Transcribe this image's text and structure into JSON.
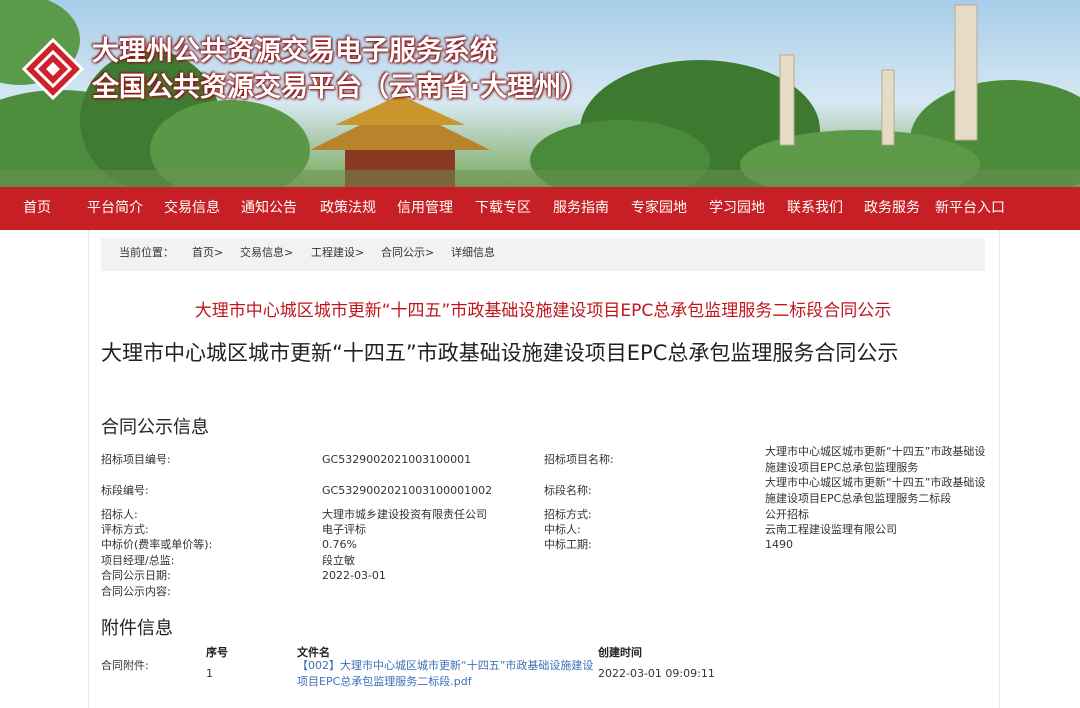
{
  "header": {
    "title_line1": "大理州公共资源交易电子服务系统",
    "title_line2": "全国公共资源交易平台（云南省·大理州）",
    "logo_icon": "diamond-logo-icon"
  },
  "nav": {
    "items": [
      "首页",
      "平台简介",
      "交易信息",
      "通知公告",
      "政策法规",
      "信用管理",
      "下载专区",
      "服务指南",
      "专家园地",
      "学习园地",
      "联系我们",
      "政务服务",
      "新平台入口"
    ]
  },
  "breadcrumb": {
    "label": "当前位置：",
    "items": [
      "首页>",
      "交易信息>",
      "工程建设>",
      "合同公示>",
      "详细信息"
    ]
  },
  "page": {
    "red_title": "大理市中心城区城市更新“十四五”市政基础设施建设项目EPC总承包监理服务二标段合同公示",
    "main_title": "大理市中心城区城市更新“十四五”市政基础设施建设项目EPC总承包监理服务合同公示"
  },
  "contract": {
    "section_title": "合同公示信息",
    "fields": {
      "project_no_label": "招标项目编号:",
      "project_no": "GC5329002021003100001",
      "project_name_label": "招标项目名称:",
      "project_name": "大理市中心城区城市更新“十四五”市政基础设施建设项目EPC总承包监理服务",
      "section_no_label": "标段编号:",
      "section_no": "GC5329002021003100001002",
      "section_name_label": "标段名称:",
      "section_name": "大理市中心城区城市更新“十四五”市政基础设施建设项目EPC总承包监理服务二标段",
      "tenderer_label": "招标人:",
      "tenderer": "大理市城乡建设投资有限责任公司",
      "method_label": "招标方式:",
      "method": "公开招标",
      "eval_label": "评标方式:",
      "eval": "电子评标",
      "winner_label": "中标人:",
      "winner": "云南工程建设监理有限公司",
      "price_label": "中标价(费率或单价等):",
      "price": "0.76%",
      "period_label": "中标工期:",
      "period": "1490",
      "manager_label": "项目经理/总监:",
      "manager": "段立敏",
      "date_label": "合同公示日期:",
      "date": "2022-03-01",
      "content_label": "合同公示内容:"
    }
  },
  "attachments": {
    "section_title": "附件信息",
    "label": "合同附件:",
    "headers": {
      "no": "序号",
      "file": "文件名",
      "created": "创建时间"
    },
    "rows": [
      {
        "no": "1",
        "file": "【002】大理市中心城区城市更新“十四五”市政基础设施建设项目EPC总承包监理服务二标段.pdf",
        "created": "2022-03-01 09:09:11"
      }
    ]
  },
  "colors": {
    "nav_bg": "#c71f26",
    "title_red": "#c0151c",
    "link_blue": "#3c6fb8"
  }
}
